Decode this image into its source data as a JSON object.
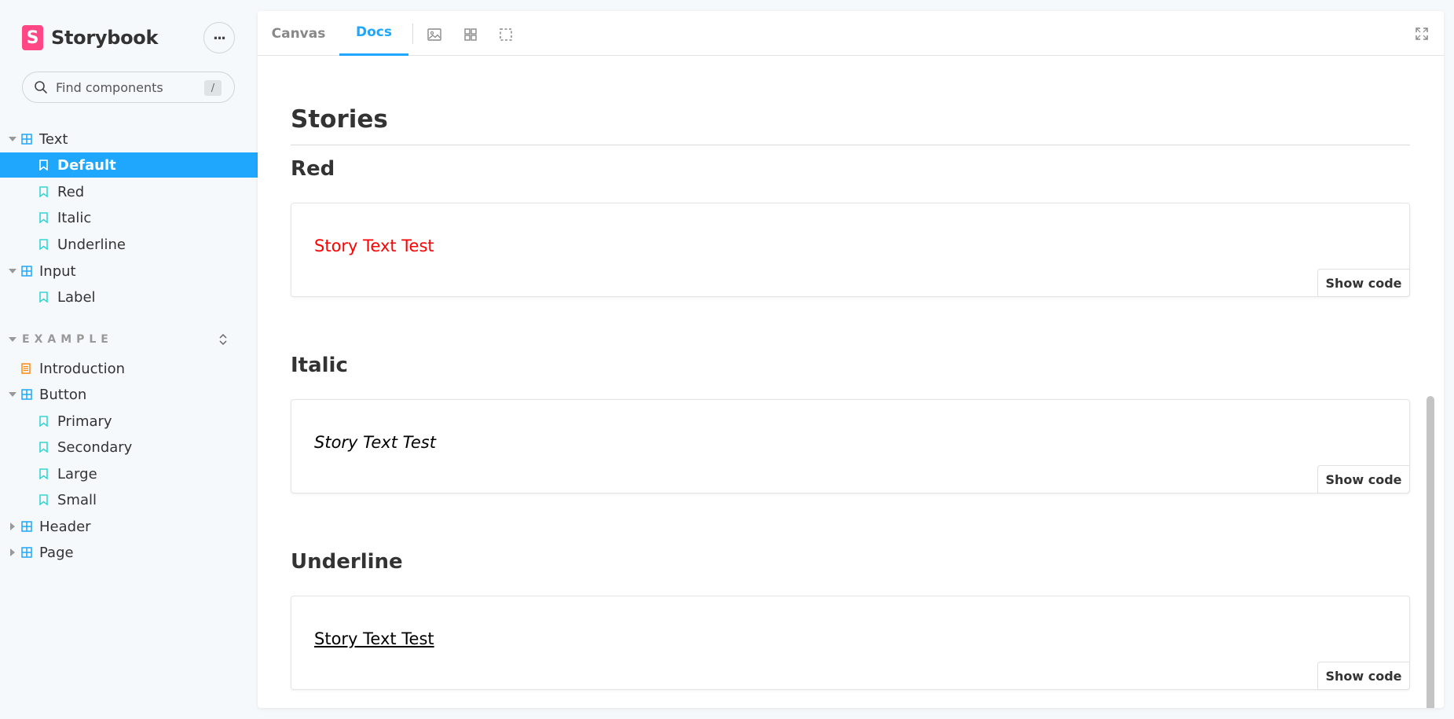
{
  "brand": {
    "name": "Storybook",
    "logo_letter": "S"
  },
  "search": {
    "placeholder": "Find components",
    "shortcut": "/"
  },
  "sidebar": {
    "tree": [
      {
        "label": "Text",
        "type": "component",
        "expanded": true
      },
      {
        "label": "Default",
        "type": "story",
        "selected": true
      },
      {
        "label": "Red",
        "type": "story"
      },
      {
        "label": "Italic",
        "type": "story"
      },
      {
        "label": "Underline",
        "type": "story"
      },
      {
        "label": "Input",
        "type": "component",
        "expanded": true
      },
      {
        "label": "Label",
        "type": "story"
      }
    ],
    "section": {
      "label": "EXAMPLE"
    },
    "example_tree": [
      {
        "label": "Introduction",
        "type": "document"
      },
      {
        "label": "Button",
        "type": "component",
        "expanded": true
      },
      {
        "label": "Primary",
        "type": "story"
      },
      {
        "label": "Secondary",
        "type": "story"
      },
      {
        "label": "Large",
        "type": "story"
      },
      {
        "label": "Small",
        "type": "story"
      },
      {
        "label": "Header",
        "type": "component",
        "expanded": false
      },
      {
        "label": "Page",
        "type": "component",
        "expanded": false
      }
    ]
  },
  "toolbar": {
    "tabs": [
      {
        "label": "Canvas"
      },
      {
        "label": "Docs",
        "active": true
      }
    ]
  },
  "docs": {
    "heading": "Stories",
    "stories": [
      {
        "title": "Red",
        "preview_text": "Story Text Test",
        "button": "Show code"
      },
      {
        "title": "Italic",
        "preview_text": "Story Text Test",
        "button": "Show code"
      },
      {
        "title": "Underline",
        "preview_text": "Story Text Test",
        "button": "Show code"
      }
    ]
  },
  "colors": {
    "accent": "#1ea7fd",
    "brand": "#ff4785",
    "story_icon": "#37d5d3",
    "component_icon": "#1ea7fd",
    "document_icon": "#ff8300",
    "red_text": "#ff0000"
  }
}
